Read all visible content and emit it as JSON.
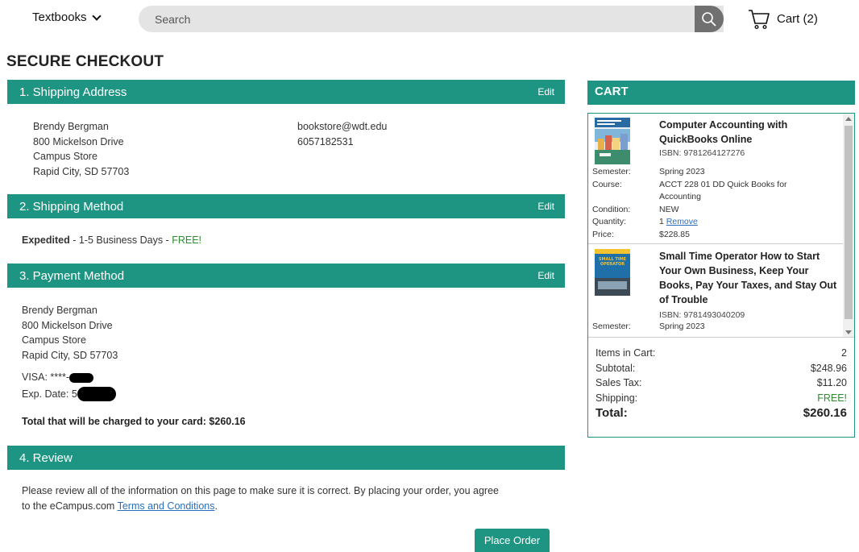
{
  "nav": {
    "textbooks_label": "Textbooks",
    "search_placeholder": "Search",
    "cart_label": "Cart (2)"
  },
  "page_title": "SECURE CHECKOUT",
  "shipping_address": {
    "header": "1. Shipping Address",
    "edit_label": "Edit",
    "name": "Brendy Bergman",
    "street": "800 Mickelson Drive",
    "line2": "Campus Store",
    "city": "Rapid City, SD 57703",
    "email": "bookstore@wdt.edu",
    "phone": "6057182531"
  },
  "shipping_method": {
    "header": "2. Shipping Method",
    "edit_label": "Edit",
    "method": "Expedited",
    "detail": " - 1-5 Business Days - ",
    "price": "FREE!"
  },
  "payment_method": {
    "header": "3. Payment Method",
    "edit_label": "Edit",
    "name": "Brendy Bergman",
    "street": "800 Mickelson Drive",
    "line2": "Campus Store",
    "city": "Rapid City, SD 57703",
    "card_label": "VISA: ****-",
    "exp_label": "Exp. Date: 5",
    "total_text": "Total that will be charged to your card: $260.16"
  },
  "review": {
    "header": "4. Review",
    "text_1": "Please review all of the information on this page to make sure it is correct. By placing your order, you agree",
    "text_2": "to the eCampus.com ",
    "terms_link": "Terms and Conditions",
    "text_end": ".",
    "place_order_label": "Place Order"
  },
  "cart": {
    "header": "CART",
    "items": [
      {
        "title": "Computer Accounting with QuickBooks Online",
        "isbn": "ISBN: 9781264127276",
        "semester_label": "Semester:",
        "semester": "Spring 2023",
        "course_label": "Course:",
        "course": "ACCT 228 01 DD Quick Books for Accounting",
        "condition_label": "Condition:",
        "condition": "NEW",
        "quantity_label": "Quantity:",
        "quantity": "1",
        "remove_label": "Remove",
        "price_label": "Price:",
        "price": "$228.85",
        "cover_text": ""
      },
      {
        "title": "Small Time Operator How to Start Your Own Business, Keep Your Books, Pay Your Taxes, and Stay Out of Trouble",
        "isbn": "ISBN: 9781493040209",
        "semester_label": "Semester:",
        "semester": "Spring 2023",
        "cover_text": "SMALL TIME OPERATOR"
      }
    ],
    "summary": {
      "items_label": "Items in Cart:",
      "items_value": "2",
      "subtotal_label": "Subtotal:",
      "subtotal_value": "$248.96",
      "tax_label": "Sales Tax:",
      "tax_value": "$11.20",
      "shipping_label": "Shipping:",
      "shipping_value": "FREE!",
      "total_label": "Total:",
      "total_value": "$260.16"
    }
  },
  "colors": {
    "accent": "#1e9583",
    "free_green": "#2e8b2e",
    "link_blue": "#2a6ebb"
  }
}
